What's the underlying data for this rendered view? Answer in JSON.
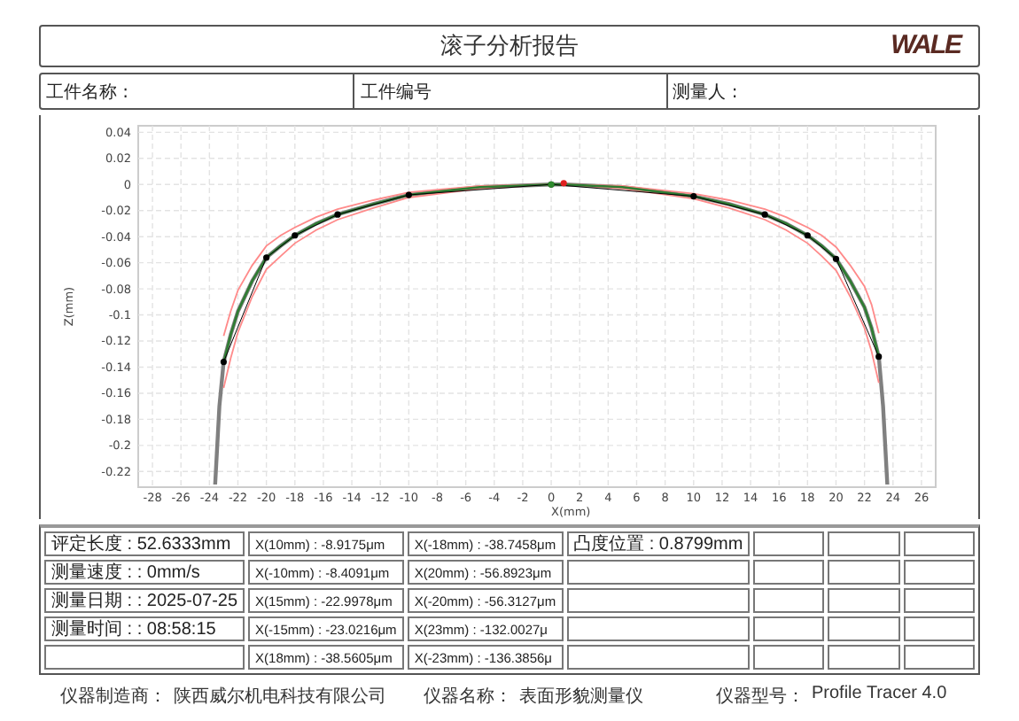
{
  "header": {
    "title": "滚子分析报告",
    "logo": "WALE"
  },
  "info": [
    {
      "label": "工件名称 :"
    },
    {
      "label": "工件编号"
    },
    {
      "label": "测量人 :"
    }
  ],
  "chart": {
    "chart_data": {
      "type": "line",
      "xlabel": "X(mm)",
      "ylabel": "Z(mm)",
      "grid": true,
      "xlim": [
        -29,
        27
      ],
      "ylim": [
        -0.232,
        0.045
      ],
      "xticks": [
        -28,
        -26,
        -24,
        -22,
        -20,
        -18,
        -16,
        -14,
        -12,
        -10,
        -8,
        -6,
        -4,
        -2,
        0,
        2,
        4,
        6,
        8,
        10,
        12,
        14,
        16,
        18,
        20,
        22,
        24,
        26
      ],
      "yticks": [
        0.04,
        0.02,
        0,
        -0.02,
        -0.04,
        -0.06,
        -0.08,
        -0.1,
        -0.12,
        -0.14,
        -0.16,
        -0.18,
        -0.2,
        -0.22
      ],
      "x": [
        -23.6,
        -23.3,
        -23,
        -22.5,
        -22,
        -21,
        -20,
        -19,
        -18,
        -16.5,
        -15,
        -12.5,
        -10,
        -5,
        0,
        0.44,
        0.88,
        5,
        10,
        12.5,
        15,
        16.5,
        18,
        19,
        20,
        21,
        22,
        22.5,
        23,
        23.3,
        23.6
      ],
      "series": [
        {
          "color": "#808080",
          "values": [
            -0.23,
            -0.17,
            -0.136,
            -0.115,
            -0.097,
            -0.074,
            -0.056,
            -0.047,
            -0.039,
            -0.03,
            -0.023,
            -0.015,
            -0.008,
            -0.002,
            0,
            0,
            0,
            -0.002,
            -0.009,
            -0.015,
            -0.023,
            -0.03,
            -0.039,
            -0.047,
            -0.057,
            -0.074,
            -0.094,
            -0.11,
            -0.132,
            -0.17,
            -0.23
          ]
        },
        {
          "color": "#ff8a8a",
          "values": [
            null,
            null,
            -0.116,
            -0.097,
            -0.081,
            -0.062,
            -0.047,
            -0.039,
            -0.033,
            -0.025,
            -0.019,
            -0.012,
            -0.006,
            -0.001,
            0,
            0,
            0,
            -0.001,
            -0.007,
            -0.012,
            -0.019,
            -0.025,
            -0.033,
            -0.039,
            -0.048,
            -0.062,
            -0.078,
            -0.092,
            -0.114,
            null,
            null
          ]
        },
        {
          "color": "#ff8a8a",
          "values": [
            null,
            null,
            -0.156,
            -0.133,
            -0.113,
            -0.086,
            -0.065,
            -0.055,
            -0.045,
            -0.035,
            -0.027,
            -0.018,
            -0.01,
            -0.003,
            0,
            0,
            0,
            -0.003,
            -0.011,
            -0.018,
            -0.027,
            -0.035,
            -0.045,
            -0.055,
            -0.066,
            -0.086,
            -0.11,
            -0.128,
            -0.152,
            null,
            null
          ]
        },
        {
          "color": "#2e7d32",
          "values": [
            null,
            null,
            -0.136,
            -0.115,
            -0.097,
            -0.074,
            -0.056,
            -0.047,
            -0.039,
            -0.03,
            -0.023,
            -0.015,
            -0.008,
            -0.002,
            0,
            0,
            0,
            -0.002,
            -0.009,
            -0.015,
            -0.023,
            -0.03,
            -0.039,
            -0.047,
            -0.057,
            -0.074,
            -0.094,
            -0.11,
            -0.132,
            null,
            null
          ]
        },
        {
          "color": "#000000",
          "marker": true,
          "values": [
            null,
            null,
            -0.136,
            null,
            null,
            null,
            -0.056,
            null,
            -0.039,
            null,
            -0.023,
            null,
            -0.008,
            null,
            0,
            null,
            null,
            null,
            -0.009,
            null,
            -0.023,
            null,
            -0.039,
            null,
            -0.057,
            null,
            null,
            null,
            -0.132,
            null,
            null
          ]
        },
        {
          "color": "#2e8b2e",
          "marker": true,
          "values": [
            null,
            null,
            null,
            null,
            null,
            null,
            null,
            null,
            null,
            null,
            null,
            null,
            null,
            null,
            0,
            null,
            null,
            null,
            null,
            null,
            null,
            null,
            null,
            null,
            null,
            null,
            null,
            null,
            null,
            null,
            null
          ]
        },
        {
          "color": "#e02020",
          "marker": true,
          "values": [
            null,
            null,
            null,
            null,
            null,
            null,
            null,
            null,
            null,
            null,
            null,
            null,
            null,
            null,
            null,
            null,
            0.001,
            null,
            null,
            null,
            null,
            null,
            null,
            null,
            null,
            null,
            null,
            null,
            null,
            null,
            null
          ]
        }
      ]
    }
  },
  "results": {
    "columns": [
      [
        "评定长度 : 52.6333mm",
        "测量速度 : : 0mm/s",
        "测量日期 : : 2025-07-25",
        "测量时间 : : 08:58:15"
      ],
      [
        "X(10mm) : -8.9175μm",
        "X(-10mm) : -8.4091μm",
        "X(15mm) : -22.9978μm",
        "X(-15mm) : -23.0216μm",
        "X(18mm) : -38.5605μm"
      ],
      [
        "X(-18mm) : -38.7458μm",
        "X(20mm) : -56.8923μm",
        "X(-20mm) : -56.3127μm",
        "X(23mm) : -132.0027μ",
        "X(-23mm) : -136.3856μ"
      ],
      [
        "凸度位置 : 0.8799mm"
      ]
    ]
  },
  "footer": [
    {
      "label": "仪器制造商：",
      "value": "陕西威尔机电科技有限公司"
    },
    {
      "label": "仪器名称：",
      "value": "表面形貌测量仪"
    },
    {
      "label": "仪器型号：",
      "value": "Profile Tracer 4.0"
    }
  ]
}
